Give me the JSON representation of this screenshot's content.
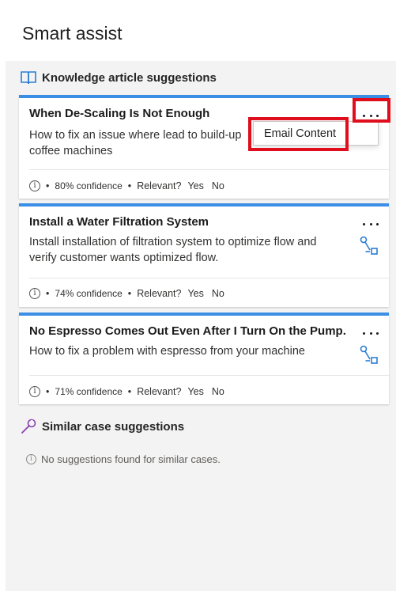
{
  "pane": {
    "title": "Smart assist"
  },
  "knowledge": {
    "heading": "Knowledge article suggestions",
    "icon": "book-icon",
    "accent_color": "#3a8ee6",
    "cards": [
      {
        "title": "When De-Scaling Is Not Enough",
        "description": "How to fix an issue where lead to build-up in coffee machines",
        "description_line1": "How to fix an issue where lead to build-up",
        "description_line2": "coffee machines",
        "confidence": "80% confidence",
        "relevant_label": "Relevant?",
        "yes": "Yes",
        "no": "No"
      },
      {
        "title": "Install a Water Filtration System",
        "description": "Install installation of filtration system to optimize flow and verify customer wants optimized flow.",
        "confidence": "74% confidence",
        "relevant_label": "Relevant?",
        "yes": "Yes",
        "no": "No"
      },
      {
        "title": "No Espresso Comes Out Even After I Turn On the Pump.",
        "description": "How to fix a problem with espresso from your machine",
        "confidence": "71% confidence",
        "relevant_label": "Relevant?",
        "yes": "Yes",
        "no": "No"
      }
    ]
  },
  "menu": {
    "item": "Email Content"
  },
  "similar": {
    "heading": "Similar case suggestions",
    "icon": "wrench-icon",
    "icon_color": "#8a3fb0",
    "empty_text": "No suggestions found for similar cases."
  },
  "highlight_color": "#e00e1c"
}
